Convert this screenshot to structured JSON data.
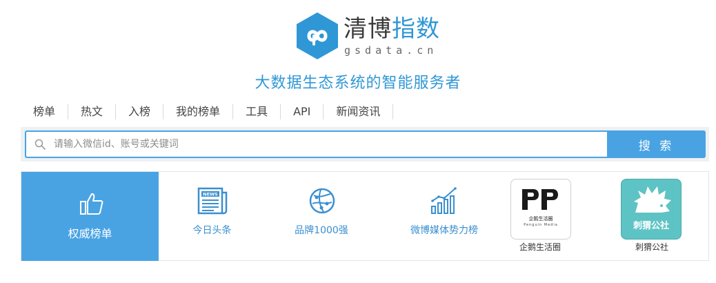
{
  "logo": {
    "word_part1": "清博",
    "word_part2": "指数",
    "domain": "gsdata.cn"
  },
  "slogan": "大数据生态系统的智能服务者",
  "nav": {
    "items": [
      "榜单",
      "热文",
      "入榜",
      "我的榜单",
      "工具",
      "API",
      "新闻资讯"
    ]
  },
  "search": {
    "placeholder": "请输入微信id、账号或关键词",
    "button_label": "搜 索"
  },
  "categories": [
    {
      "label": "权威榜单",
      "icon": "thumbs-up-icon",
      "active": true
    },
    {
      "label": "今日头条",
      "icon": "news-icon",
      "active": false
    },
    {
      "label": "品牌1000强",
      "icon": "globe-network-icon",
      "active": false
    },
    {
      "label": "微博媒体势力榜",
      "icon": "bar-chart-trend-icon",
      "active": false
    },
    {
      "label": "企鹅生活圈",
      "icon": "penguin-media-logo",
      "active": false
    },
    {
      "label": "刺猬公社",
      "icon": "hedgehog-logo",
      "active": false
    }
  ],
  "brand_tiles": {
    "penguin": {
      "caption": "企鹅生活圈",
      "sub": "Penguin Media"
    },
    "hedgehog": {
      "caption": "刺猬公社"
    }
  },
  "colors": {
    "brand_blue": "#2f97d6",
    "button_blue": "#49a3e3",
    "hedgehog_teal": "#5ec3c4"
  }
}
